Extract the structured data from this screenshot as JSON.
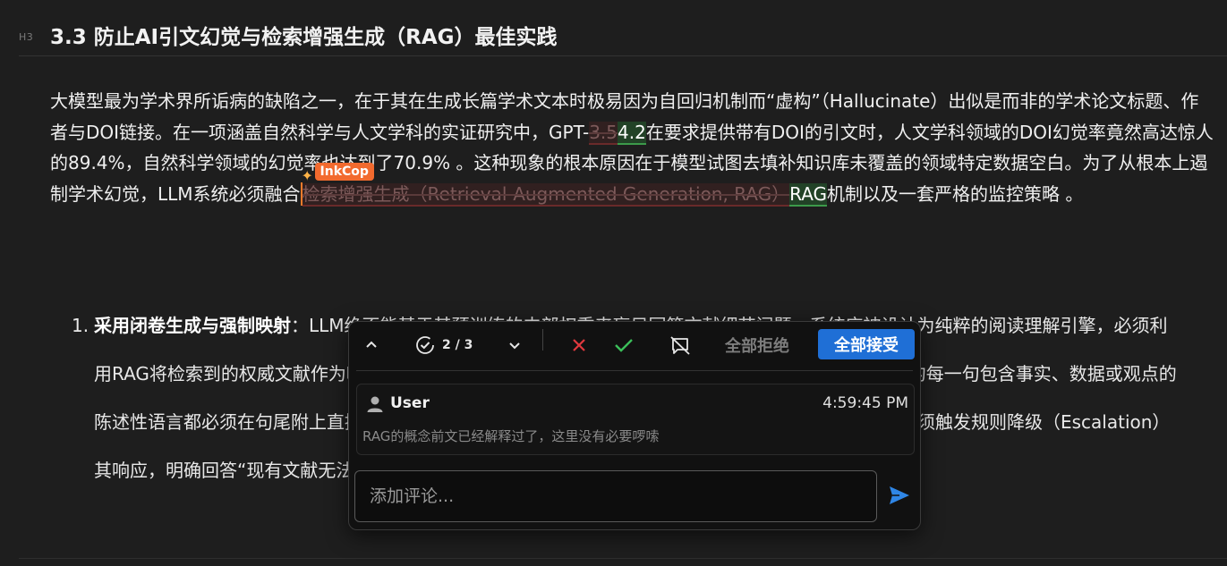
{
  "heading": {
    "marker": "H3",
    "title": "3.3 防止AI引文幻觉与检索增强生成（RAG）最佳实践"
  },
  "paragraph": {
    "p1": "大模型最为学术界所诟病的缺陷之一，在于其在生成长篇学术文本时极易因为自回归机制而“虚构”（Hallucinate）出似是而非的学术论文标题、作者与DOI链接。在一项涵盖自然科学与人文学科的实证研究中，GPT-",
    "del1": "3.5",
    "ins1": "4.2",
    "p2": "在要求提供带有DOI的引文时，人文学科领域的DOI幻觉率竟然高达惊人的89.4%，自然科学领域的幻觉率也达到了70.9% 。这种现象的根本原因在于模型试图去填补知识库未覆盖的领域特定数据空白。为了从根本上遏制学术幻觉，LLM系统必须融合",
    "del2": "检索增强生成（Retrieval-Augmented Generation, RAG）",
    "ins2": "RAG",
    "p3": "机制以及一套严格的监控策略 。"
  },
  "inkcop": {
    "badge": "InkCop",
    "accent": "#f26a2e"
  },
  "list": {
    "number": "1.",
    "bold": "采用闭卷生成与强制映射",
    "text": "：LLM绝不能基于其预训练的内部权重来盲目回答文献细节问题。系统应被设计为纯粹的阅读理解引擎，必须利用RAG将检索到的权威文献作为唯一上下文（Context）。在提示词中需施加极强约束，要求LLM：生成的每一句包含事实、数据或观点的陈述性语言都必须在句尾附上直接指向原始证据的数字引用标记；若检索到的上下文中找不到答案，则必须触发规则降级（Escalation）其响应，明确回答“现有文献无法支持该论点”。"
  },
  "review": {
    "counter": "2 / 3",
    "reject_all": "全部拒绝",
    "accept_all": "全部接受",
    "accept_color": "#1f6fd6",
    "comment": {
      "user": "User",
      "time": "4:59:45 PM",
      "text": "RAG的概念前文已经解释过了，这里没有必要啰嗦"
    },
    "input_placeholder": "添加评论..."
  }
}
